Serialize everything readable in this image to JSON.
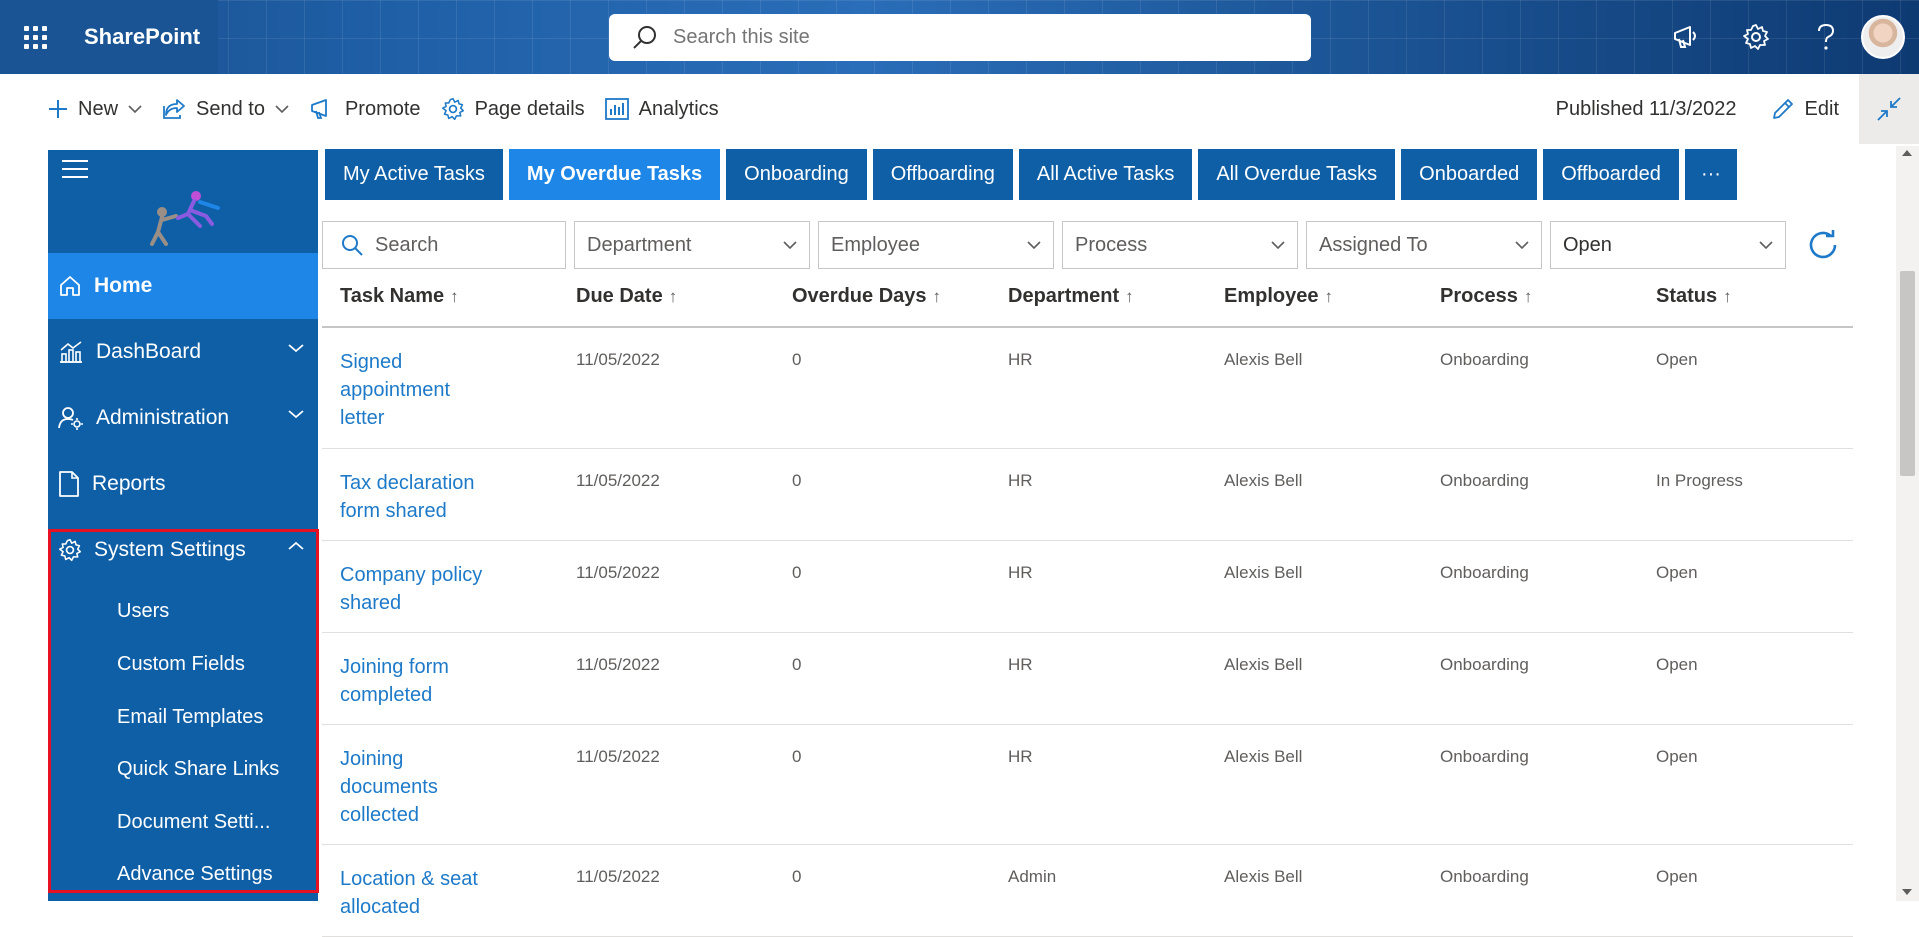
{
  "suite": {
    "brand": "SharePoint",
    "search_placeholder": "Search this site",
    "icons": [
      "waffle-icon",
      "megaphone-icon",
      "gear-icon",
      "help-icon"
    ]
  },
  "command_bar": {
    "new_label": "New",
    "send_to_label": "Send to",
    "promote_label": "Promote",
    "page_details_label": "Page details",
    "analytics_label": "Analytics",
    "published": "Published 11/3/2022",
    "edit_label": "Edit"
  },
  "nav": {
    "home": "Home",
    "dashboard": "DashBoard",
    "administration": "Administration",
    "reports": "Reports",
    "system_settings": "System Settings",
    "sub_items": [
      "Users",
      "Custom Fields",
      "Email Templates",
      "Quick Share Links",
      "Document Setti...",
      "Advance Settings"
    ]
  },
  "tabs": [
    {
      "label": "My Active Tasks"
    },
    {
      "label": "My Overdue Tasks"
    },
    {
      "label": "Onboarding"
    },
    {
      "label": "Offboarding"
    },
    {
      "label": "All Active Tasks"
    },
    {
      "label": "All Overdue Tasks"
    },
    {
      "label": "Onboarded"
    },
    {
      "label": "Offboarded"
    },
    {
      "label": "···"
    }
  ],
  "filters": {
    "search_placeholder": "Search",
    "department": "Department",
    "employee": "Employee",
    "process": "Process",
    "assigned_to": "Assigned To",
    "status": "Open"
  },
  "table": {
    "columns": [
      "Task Name",
      "Due Date",
      "Overdue Days",
      "Department",
      "Employee",
      "Process",
      "Status"
    ],
    "sort_arrow": "↑",
    "rows": [
      {
        "task": "Signed appointment letter",
        "due": "11/05/2022",
        "overdue": "0",
        "dept": "HR",
        "employee": "Alexis Bell",
        "process": "Onboarding",
        "status": "Open"
      },
      {
        "task": "Tax declaration form shared",
        "due": "11/05/2022",
        "overdue": "0",
        "dept": "HR",
        "employee": "Alexis Bell",
        "process": "Onboarding",
        "status": "In Progress"
      },
      {
        "task": "Company policy shared",
        "due": "11/05/2022",
        "overdue": "0",
        "dept": "HR",
        "employee": "Alexis Bell",
        "process": "Onboarding",
        "status": "Open"
      },
      {
        "task": "Joining form completed",
        "due": "11/05/2022",
        "overdue": "0",
        "dept": "HR",
        "employee": "Alexis Bell",
        "process": "Onboarding",
        "status": "Open"
      },
      {
        "task": "Joining documents collected",
        "due": "11/05/2022",
        "overdue": "0",
        "dept": "HR",
        "employee": "Alexis Bell",
        "process": "Onboarding",
        "status": "Open"
      },
      {
        "task": "Location & seat allocated",
        "due": "11/05/2022",
        "overdue": "0",
        "dept": "Admin",
        "employee": "Alexis Bell",
        "process": "Onboarding",
        "status": "Open"
      }
    ]
  },
  "colors": {
    "nav_bg": "#0f5fa6",
    "nav_active": "#1e86e6",
    "link": "#1e7ac8",
    "highlight": "#e81123"
  }
}
